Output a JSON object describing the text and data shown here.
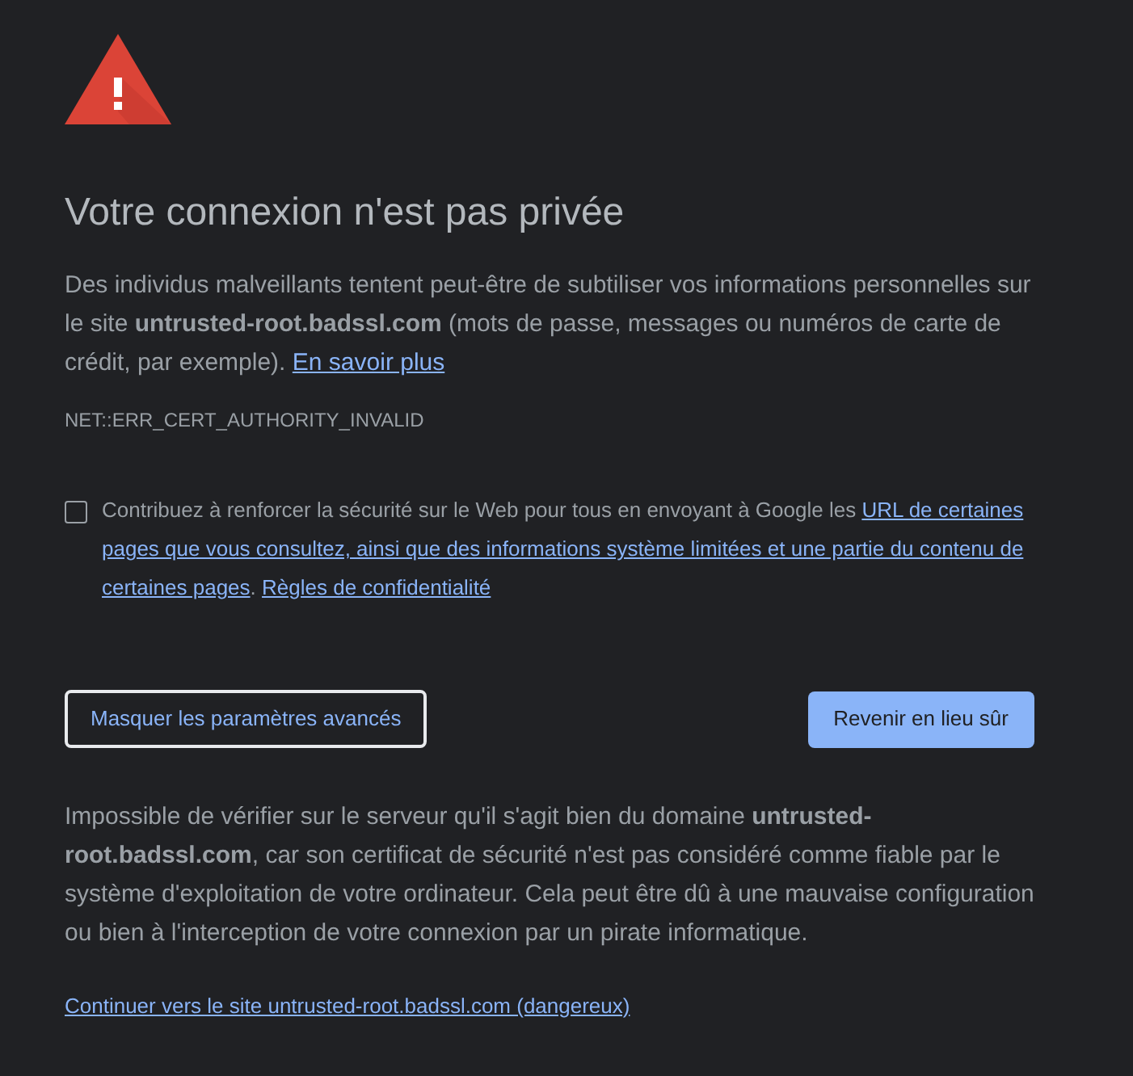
{
  "heading": "Votre connexion n'est pas privée",
  "intro": {
    "text": "Des individus malveillants tentent peut-être de subtiliser vos informations personnelles sur le site **untrusted-root.badssl.com** (mots de passe, messages ou numéros de carte de crédit, par exemple).",
    "link": "En savoir plus"
  },
  "error_code": "NET::ERR_CERT_AUTHORITY_INVALID",
  "safe_browsing": {
    "checked": false,
    "lines": [
      [
        {
          "kind": "text",
          "text": "Contribuez à renforcer la sécurité sur le Web pour tous en envoyant à Google les "
        },
        {
          "kind": "link",
          "text": "URL de certaines"
        }
      ],
      [
        {
          "kind": "link",
          "text": "pages que vous consultez, ainsi que des informations système limitées et une partie du contenu de"
        }
      ],
      [
        {
          "kind": "link",
          "text": "certaines pages"
        },
        {
          "kind": "text",
          "text": ". "
        },
        {
          "kind": "link",
          "text": "Règles de confidentialité"
        }
      ]
    ]
  },
  "buttons": [
    {
      "kind": "secondary",
      "label": "Masquer les paramètres avancés",
      "focused": true
    },
    {
      "kind": "primary",
      "label": "Revenir en lieu sûr",
      "focused": false
    }
  ],
  "details": "Impossible de vérifier sur le serveur qu'il s'agit bien du domaine **untrusted-root.badssl.com**, car son certificat de sécurité n'est pas considéré comme fiable par le système d'exploitation de votre ordinateur. Cela peut être dû à une mauvaise configuration ou bien à l'interception de votre connexion par un pirate informatique.",
  "proceed_link": "Continuer vers le site untrusted-root.badssl.com (dangereux)"
}
